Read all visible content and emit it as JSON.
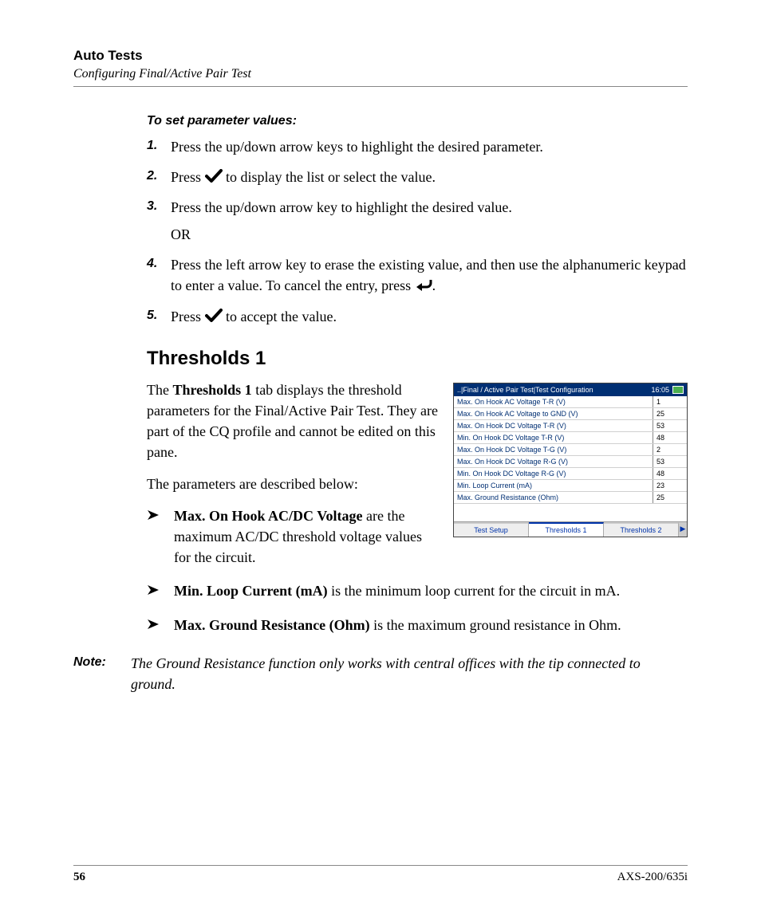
{
  "header": {
    "title": "Auto Tests",
    "subtitle": "Configuring Final/Active Pair Test"
  },
  "procedure": {
    "title": "To set parameter values:",
    "steps": [
      {
        "num": "1.",
        "text_before": "Press the up/down arrow keys to highlight the desired parameter.",
        "icon": null,
        "text_after": "",
        "or_after": false
      },
      {
        "num": "2.",
        "text_before": "Press ",
        "icon": "check",
        "text_after": " to display the list or select the value.",
        "or_after": false
      },
      {
        "num": "3.",
        "text_before": "Press the up/down arrow key to highlight the desired value.",
        "icon": null,
        "text_after": "",
        "or_after": true,
        "or_text": "OR"
      },
      {
        "num": "4.",
        "text_before": "Press the left arrow key to erase the existing value, and then use the alphanumeric keypad to enter a value. To cancel the entry, press ",
        "icon": "back",
        "text_after": ".",
        "or_after": false
      },
      {
        "num": "5.",
        "text_before": "Press ",
        "icon": "check",
        "text_after": " to accept the value.",
        "or_after": false
      }
    ]
  },
  "section": {
    "heading": "Thresholds 1",
    "para1_a": "The ",
    "para1_bold": "Thresholds 1",
    "para1_b": " tab displays the threshold parameters for the Final/Active Pair Test. They are part of the CQ profile and cannot be edited on this pane.",
    "para2": "The parameters are described below:",
    "bullets": [
      {
        "bold": "Max. On Hook AC/DC Voltage",
        "rest": " are the maximum AC/DC threshold voltage values for the circuit."
      },
      {
        "bold": "Min. Loop Current (mA)",
        "rest": " is the minimum loop current for the circuit in mA."
      },
      {
        "bold": "Max. Ground Resistance (Ohm)",
        "rest": " is the maximum ground resistance in Ohm."
      }
    ]
  },
  "note": {
    "label": "Note:",
    "text": "The Ground Resistance function only works with central offices with the tip connected to ground."
  },
  "screenshot": {
    "titlebar": "..|Final / Active Pair Test|Test Configuration",
    "clock": "16:05",
    "rows": [
      {
        "label": "Max. On Hook AC Voltage T-R (V)",
        "value": "1"
      },
      {
        "label": "Max. On Hook AC Voltage to GND (V)",
        "value": "25"
      },
      {
        "label": "Max. On Hook DC Voltage T-R (V)",
        "value": "53"
      },
      {
        "label": "Min. On Hook DC Voltage T-R (V)",
        "value": "48"
      },
      {
        "label": "Max. On Hook DC Voltage T-G (V)",
        "value": "2"
      },
      {
        "label": "Max. On Hook DC Voltage R-G (V)",
        "value": "53"
      },
      {
        "label": "Min. On Hook DC Voltage R-G (V)",
        "value": "48"
      },
      {
        "label": "Min. Loop Current (mA)",
        "value": "23"
      },
      {
        "label": "Max. Ground Resistance (Ohm)",
        "value": "25"
      }
    ],
    "tabs": [
      "Test Setup",
      "Thresholds 1",
      "Thresholds 2"
    ],
    "active_tab": 1
  },
  "footer": {
    "page": "56",
    "model": "AXS-200/635i"
  }
}
